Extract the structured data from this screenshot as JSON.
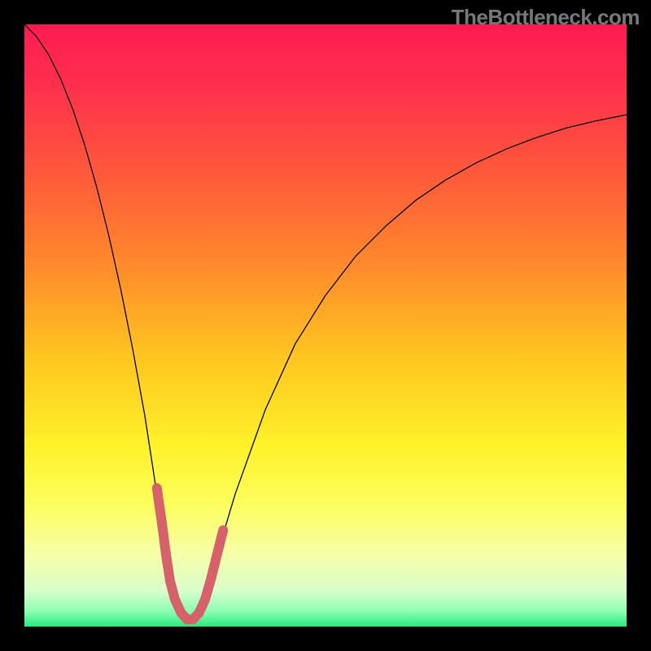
{
  "watermark": "TheBottleneck.com",
  "chart_data": {
    "type": "line",
    "title": "",
    "xlabel": "",
    "ylabel": "",
    "xlim": [
      0,
      100
    ],
    "ylim": [
      0,
      100
    ],
    "gradient_stops": [
      {
        "offset": 0.0,
        "color": "#ff1a52"
      },
      {
        "offset": 0.1,
        "color": "#ff2f4d"
      },
      {
        "offset": 0.25,
        "color": "#ff5a3a"
      },
      {
        "offset": 0.4,
        "color": "#ff8a2c"
      },
      {
        "offset": 0.55,
        "color": "#ffc51f"
      },
      {
        "offset": 0.7,
        "color": "#fff22a"
      },
      {
        "offset": 0.8,
        "color": "#fdff60"
      },
      {
        "offset": 0.88,
        "color": "#f6ffa8"
      },
      {
        "offset": 0.94,
        "color": "#d9ffca"
      },
      {
        "offset": 0.975,
        "color": "#8cffb4"
      },
      {
        "offset": 1.0,
        "color": "#27e97a"
      }
    ],
    "series": [
      {
        "name": "bottleneck-curve",
        "color": "#000000",
        "stroke_width": 1.3,
        "x": [
          0,
          2,
          4,
          6,
          8,
          10,
          12,
          14,
          16,
          18,
          20,
          22,
          23.5,
          25,
          26,
          27,
          28,
          29,
          30,
          32,
          35,
          40,
          45,
          50,
          55,
          60,
          65,
          70,
          75,
          80,
          85,
          90,
          95,
          100
        ],
        "y": [
          100,
          98,
          95,
          91,
          86,
          80,
          73,
          65,
          56,
          46,
          35,
          22,
          13,
          6,
          2.5,
          1.2,
          1.2,
          2.5,
          5.5,
          12,
          22,
          36,
          47,
          55,
          61.5,
          66.5,
          70.8,
          74.2,
          77,
          79.3,
          81.2,
          82.8,
          84,
          85
        ]
      },
      {
        "name": "sweet-spot-band",
        "color": "#d6616a",
        "stroke_width": 12,
        "linecap": "round",
        "x": [
          22.0,
          23.0,
          23.5,
          24.2,
          25.0,
          26.0,
          27.0,
          28.0,
          29.0,
          30.0,
          31.0,
          32.0,
          33.0
        ],
        "y": [
          23.0,
          16.0,
          12.0,
          7.5,
          4.5,
          2.3,
          1.2,
          1.2,
          2.3,
          4.5,
          8.0,
          12.0,
          16.0
        ]
      }
    ]
  }
}
